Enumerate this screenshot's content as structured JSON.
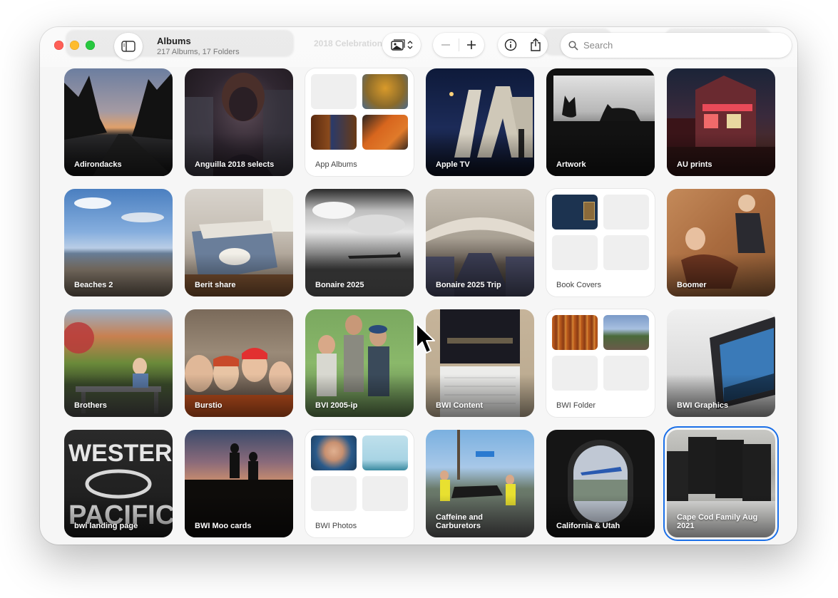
{
  "window": {
    "title": "Albums",
    "subtitle": "217 Albums, 17 Folders",
    "background_ghost_text": "2018 Celebrations"
  },
  "toolbar": {
    "sidebar_toggle_icon": "sidebar-icon",
    "view_menu_icon": "photo-stack-icon",
    "zoom_out_icon": "minus-icon",
    "zoom_in_icon": "plus-icon",
    "info_icon": "info-icon",
    "share_icon": "share-icon",
    "search_placeholder": "Search"
  },
  "albums": [
    {
      "label": "Adirondacks",
      "kind": "photo"
    },
    {
      "label": "Anguilla 2018 selects",
      "kind": "photo"
    },
    {
      "label": "App Albums",
      "kind": "folder"
    },
    {
      "label": "Apple TV",
      "kind": "photo"
    },
    {
      "label": "Artwork",
      "kind": "photo"
    },
    {
      "label": "AU prints",
      "kind": "photo"
    },
    {
      "label": "Beaches 2",
      "kind": "photo"
    },
    {
      "label": "Berit share",
      "kind": "photo"
    },
    {
      "label": "Bonaire 2025",
      "kind": "photo"
    },
    {
      "label": "Bonaire 2025 Trip",
      "kind": "photo"
    },
    {
      "label": "Book Covers",
      "kind": "folder"
    },
    {
      "label": "Boomer",
      "kind": "photo"
    },
    {
      "label": "Brothers",
      "kind": "photo"
    },
    {
      "label": "Burstio",
      "kind": "photo"
    },
    {
      "label": "BVI 2005-ip",
      "kind": "photo"
    },
    {
      "label": "BWI Content",
      "kind": "photo"
    },
    {
      "label": "BWI Folder",
      "kind": "folder"
    },
    {
      "label": "BWI Graphics",
      "kind": "photo"
    },
    {
      "label": "bwi landing page",
      "kind": "photo"
    },
    {
      "label": "BWI Moo cards",
      "kind": "photo"
    },
    {
      "label": "BWI Photos",
      "kind": "folder"
    },
    {
      "label": "Caffeine and Carburetors",
      "kind": "photo"
    },
    {
      "label": "California & Utah",
      "kind": "photo"
    },
    {
      "label": "Cape Cod Family Aug 2021",
      "kind": "photo",
      "selected": true
    }
  ],
  "colors": {
    "selection_accent": "#1a6fe8",
    "close": "#fe5f57",
    "minimize": "#febc2e",
    "zoom": "#28c840"
  }
}
